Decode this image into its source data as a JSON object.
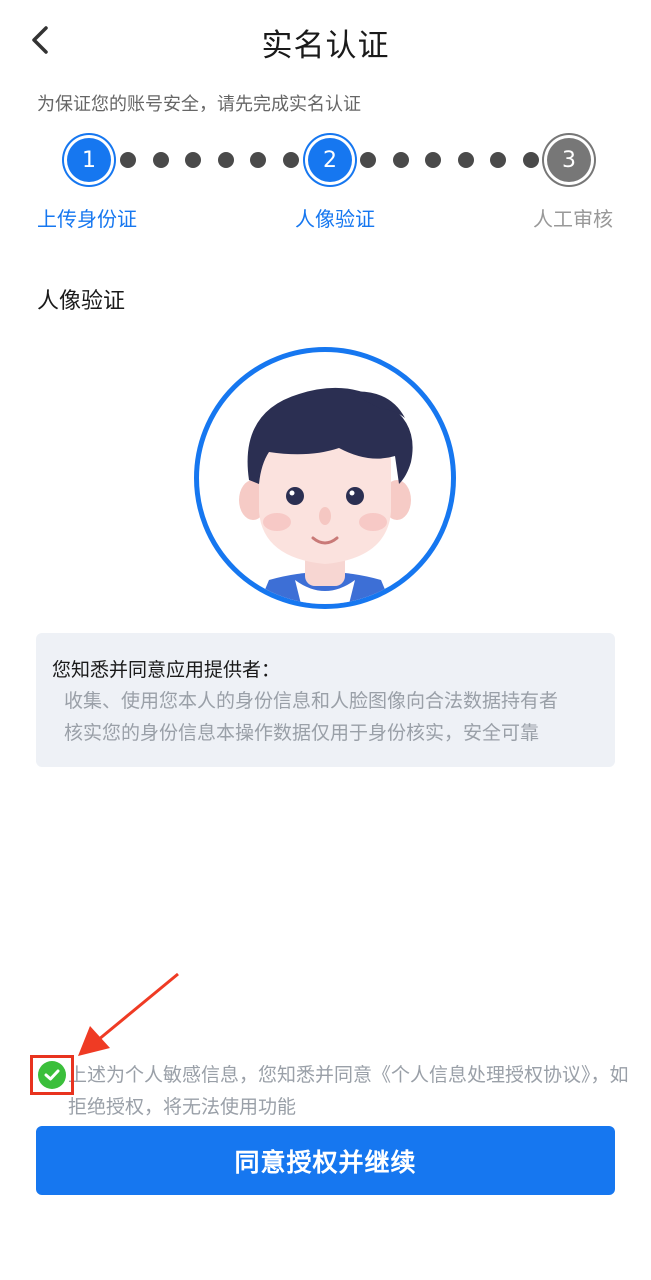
{
  "header": {
    "title": "实名认证",
    "back_icon": "chevron-left-icon"
  },
  "notice": "为保证您的账号安全，请先完成实名认证",
  "stepper": {
    "steps": [
      {
        "number": "1",
        "label": "上传身份证",
        "state": "active"
      },
      {
        "number": "2",
        "label": "人像验证",
        "state": "active"
      },
      {
        "number": "3",
        "label": "人工审核",
        "state": "inactive"
      }
    ],
    "active_color": "#1677f0",
    "inactive_color": "#777777"
  },
  "section": {
    "title": "人像验证"
  },
  "info": {
    "heading": "您知悉并同意应用提供者：",
    "lines": [
      "收集、使用您本人的身份信息和人脸图像向合法数据持有者",
      "核实您的身份信息本操作数据仅用于身份核实，安全可靠"
    ]
  },
  "agreement": {
    "checked": true,
    "text": "上述为个人敏感信息，您知悉并同意《个人信息处理授权协议》，如拒绝授权，将无法使用功能"
  },
  "primary_button": {
    "label": "同意授权并继续",
    "color": "#1677f0"
  }
}
